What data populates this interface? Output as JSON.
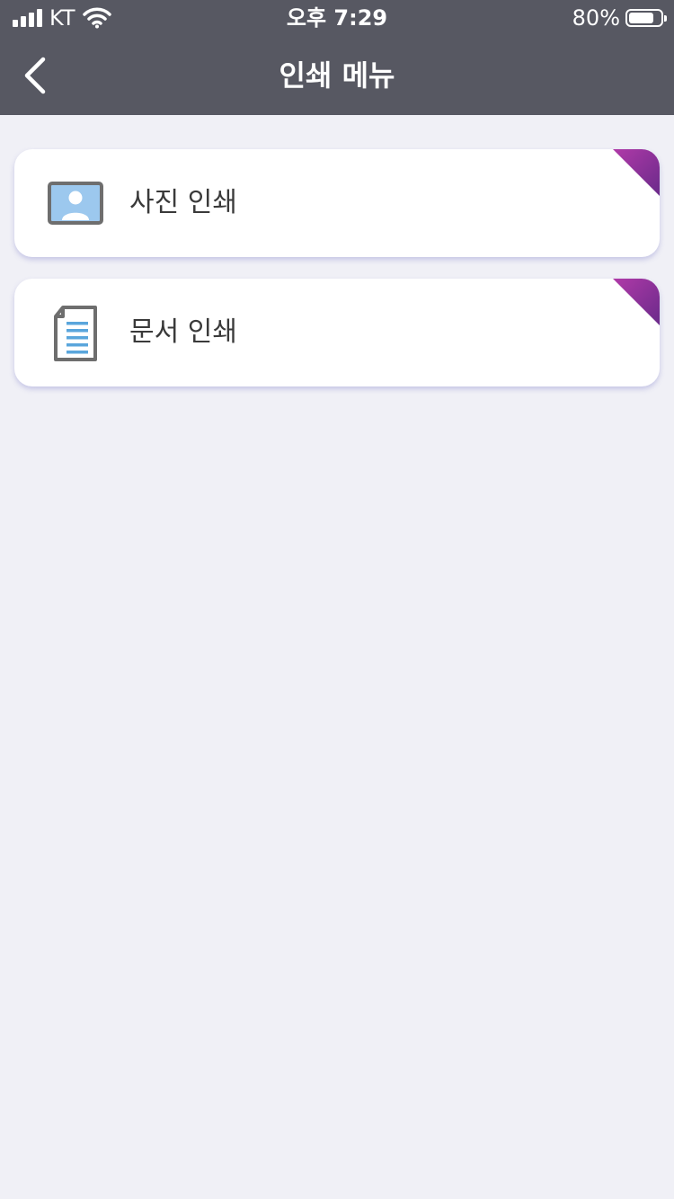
{
  "status_bar": {
    "carrier": "KT",
    "time": "오후 7:29",
    "battery_percent_text": "80%",
    "battery_level": 0.8
  },
  "nav": {
    "title": "인쇄 메뉴"
  },
  "menu": {
    "items": [
      {
        "label": "사진 인쇄",
        "icon": "photo-icon"
      },
      {
        "label": "문서 인쇄",
        "icon": "document-icon"
      }
    ]
  },
  "colors": {
    "header_bg": "#575862",
    "page_bg": "#f0f0f6",
    "card_bg": "#ffffff",
    "accent_purple": "#8b2a8f",
    "icon_blue": "#9cc8ee"
  }
}
